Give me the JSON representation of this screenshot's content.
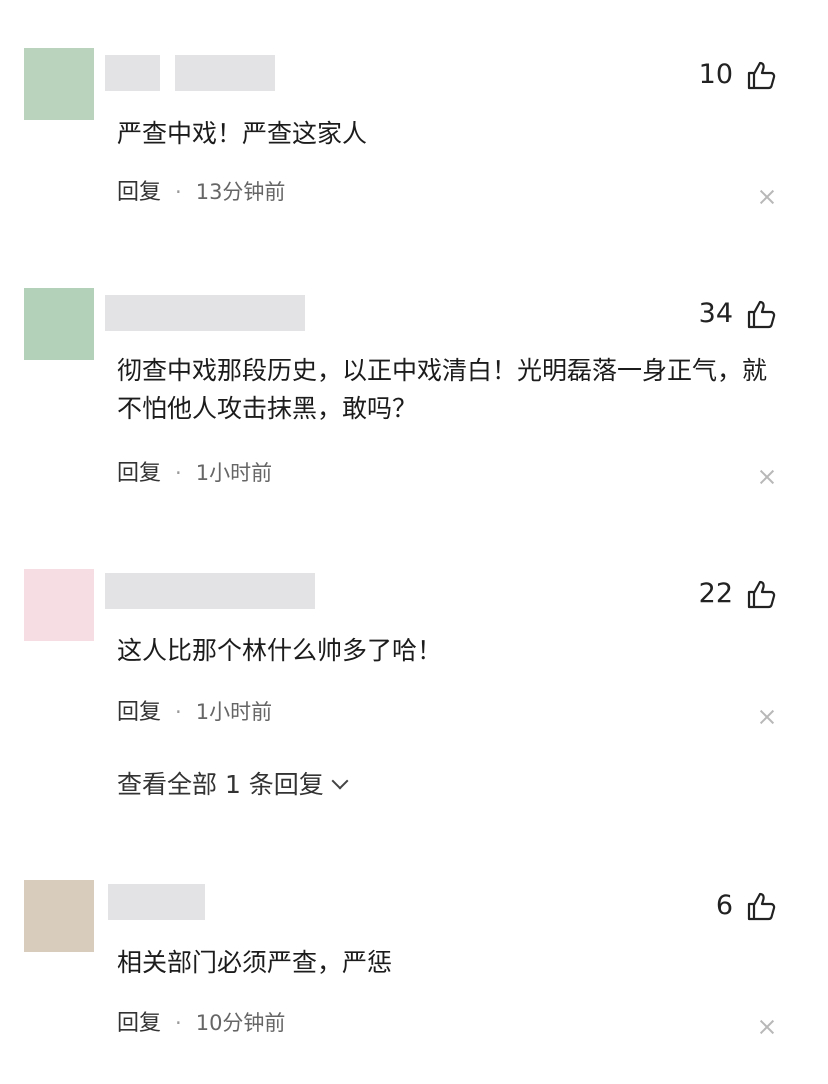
{
  "comments": [
    {
      "avatar_color": "#b9d3bc",
      "likes": "10",
      "text": "严查中戏！严查这家人",
      "reply_label": "回复",
      "separator": "·",
      "time": "13分钟前"
    },
    {
      "avatar_color": "#b3d1b9",
      "likes": "34",
      "text": "彻查中戏那段历史，以正中戏清白！光明磊落一身正气，就不怕他人攻击抹黑，敢吗？",
      "reply_label": "回复",
      "separator": "·",
      "time": "1小时前"
    },
    {
      "avatar_color": "#f6dce3",
      "likes": "22",
      "text": "这人比那个林什么帅多了哈！",
      "reply_label": "回复",
      "separator": "·",
      "time": "1小时前",
      "view_replies": "查看全部 1 条回复"
    },
    {
      "avatar_color": "#d8ccbd",
      "likes": "6",
      "text": "相关部门必须严查，严惩",
      "reply_label": "回复",
      "separator": "·",
      "time": "10分钟前"
    }
  ],
  "icons": {
    "like": "thumbs-up-icon",
    "dismiss": "close-icon",
    "expand": "chevron-down-icon"
  }
}
